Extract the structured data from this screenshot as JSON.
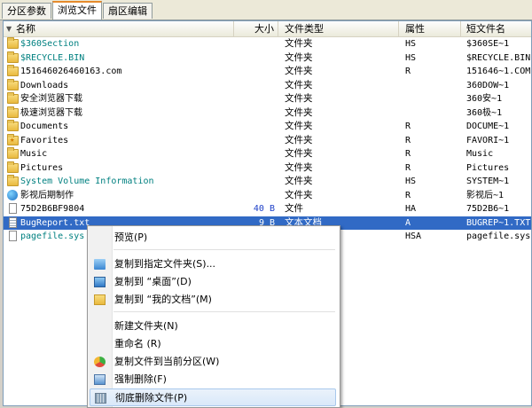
{
  "tabs": [
    "分区参数",
    "浏览文件",
    "扇区编辑"
  ],
  "active_tab": 1,
  "columns": {
    "name": "名称",
    "size": "大小",
    "type": "文件类型",
    "attr": "属性",
    "short": "短文件名"
  },
  "sort_icon": "sort-down-icon",
  "rows": [
    {
      "name": "$360Section",
      "size": "",
      "type": "文件夹",
      "attr": "HS",
      "short": "$360SE~1",
      "icon": "folder-icon",
      "color": "teal"
    },
    {
      "name": "$RECYCLE.BIN",
      "size": "",
      "type": "文件夹",
      "attr": "HS",
      "short": "$RECYCLE.BIN",
      "icon": "folder-icon",
      "color": "teal"
    },
    {
      "name": "151646026460163.com",
      "size": "",
      "type": "文件夹",
      "attr": "R",
      "short": "151646~1.COM",
      "icon": "folder-icon",
      "color": ""
    },
    {
      "name": "Downloads",
      "size": "",
      "type": "文件夹",
      "attr": "",
      "short": "360DOW~1",
      "icon": "folder-icon",
      "color": ""
    },
    {
      "name": "安全浏览器下载",
      "size": "",
      "type": "文件夹",
      "attr": "",
      "short": "360安~1",
      "icon": "folder-icon",
      "color": ""
    },
    {
      "name": "极速浏览器下载",
      "size": "",
      "type": "文件夹",
      "attr": "",
      "short": "360极~1",
      "icon": "folder-icon",
      "color": ""
    },
    {
      "name": "Documents",
      "size": "",
      "type": "文件夹",
      "attr": "R",
      "short": "DOCUME~1",
      "icon": "folder-icon",
      "color": ""
    },
    {
      "name": "Favorites",
      "size": "",
      "type": "文件夹",
      "attr": "R",
      "short": "FAVORI~1",
      "icon": "folder-star-icon",
      "color": ""
    },
    {
      "name": "Music",
      "size": "",
      "type": "文件夹",
      "attr": "R",
      "short": "Music",
      "icon": "folder-icon",
      "color": ""
    },
    {
      "name": "Pictures",
      "size": "",
      "type": "文件夹",
      "attr": "R",
      "short": "Pictures",
      "icon": "folder-icon",
      "color": ""
    },
    {
      "name": "System Volume Information",
      "size": "",
      "type": "文件夹",
      "attr": "HS",
      "short": "SYSTEM~1",
      "icon": "folder-icon",
      "color": "teal"
    },
    {
      "name": "影视后期制作",
      "size": "",
      "type": "文件夹",
      "attr": "R",
      "short": "影视后~1",
      "icon": "globe-icon",
      "color": ""
    },
    {
      "name": "75D2B6BF9804",
      "size": "40 B",
      "type": "文件",
      "attr": "HA",
      "short": "75D2B6~1",
      "icon": "file-icon",
      "color": ""
    },
    {
      "name": "BugReport.txt",
      "size": "9 B",
      "type": "文本文档",
      "attr": "A",
      "short": "BUGREP~1.TXT",
      "icon": "text-file-icon",
      "color": "",
      "selected": true
    },
    {
      "name": "pagefile.sys",
      "size": "",
      "type": "",
      "attr": "HSA",
      "short": "pagefile.sys",
      "icon": "file-icon",
      "color": "teal"
    }
  ],
  "context_menu": {
    "items": [
      {
        "label": "预览(P)",
        "icon": ""
      },
      {
        "sep": true
      },
      {
        "label": "复制到指定文件夹(S)...",
        "icon": "copy-to-folder-icon"
      },
      {
        "label": "复制到 “桌面”(D)",
        "icon": "desktop-icon"
      },
      {
        "label": "复制到 “我的文档”(M)",
        "icon": "folder-icon"
      },
      {
        "sep": true
      },
      {
        "label": "新建文件夹(N)",
        "icon": ""
      },
      {
        "label": "重命名 (R)",
        "icon": ""
      },
      {
        "label": "复制文件到当前分区(W)",
        "icon": "copy-partition-icon"
      },
      {
        "label": "强制删除(F)",
        "icon": "force-delete-icon"
      },
      {
        "label": "彻底删除文件(P)",
        "icon": "shred-icon",
        "highlighted": true
      }
    ]
  },
  "colors": {
    "selection": "#316ac5",
    "teal_text": "#008080",
    "size_text": "#1e40c8",
    "tab_accent": "#e68b2c"
  }
}
